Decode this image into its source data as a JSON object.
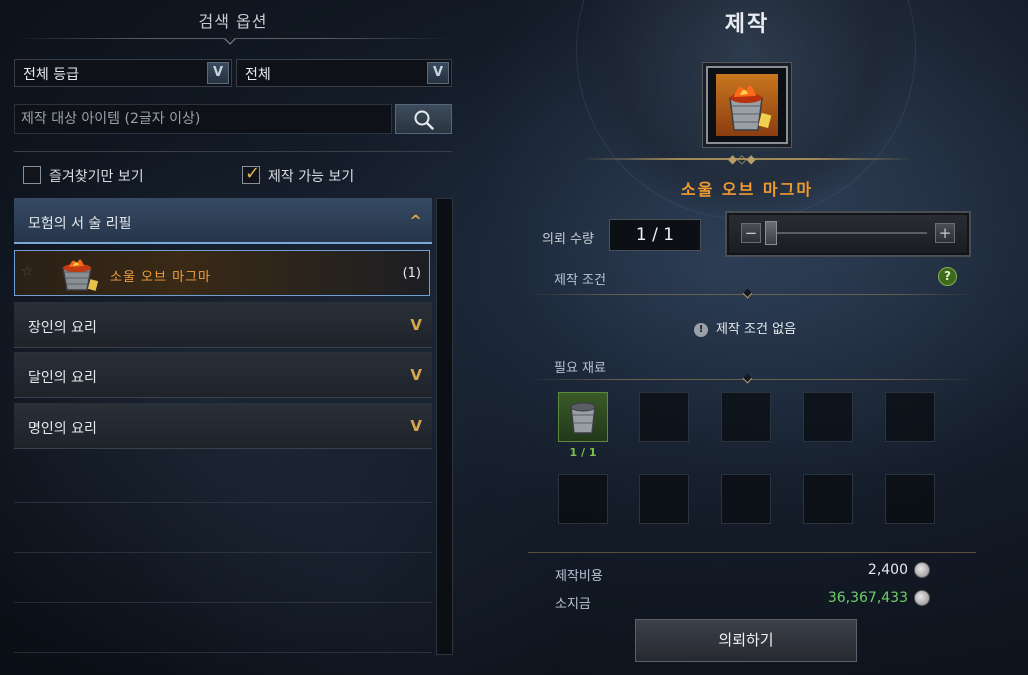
{
  "search": {
    "title": "검색 옵션",
    "grade_select": "전체 등급",
    "type_select": "전체",
    "placeholder": "제작 대상 아이템 (2글자 이상)",
    "favorites_label": "즐겨찾기만 보기",
    "favorites_checked": false,
    "craftable_label": "제작 가능 보기",
    "craftable_checked": true
  },
  "categories": [
    {
      "label": "모험의 서 술 리필",
      "expanded": true
    },
    {
      "label": "장인의 요리",
      "expanded": false
    },
    {
      "label": "달인의 요리",
      "expanded": false
    },
    {
      "label": "명인의 요리",
      "expanded": false
    }
  ],
  "selected_item": {
    "name": "소울 오브 마그마",
    "count": "(1)"
  },
  "craft": {
    "title": "제작",
    "item_name": "소울 오브 마그마",
    "quantity_label": "의뢰 수량",
    "quantity_value": "1 / 1",
    "minus": "−",
    "plus": "+",
    "conditions_label": "제작 조건",
    "help": "?",
    "no_condition": "제작 조건 없음",
    "info_icon": "!",
    "materials_label": "필요 재료",
    "material_count": "1 / 1",
    "cost_label": "제작비용",
    "cost_value": "2,400",
    "funds_label": "소지금",
    "funds_value": "36,367,433",
    "request_button": "의뢰하기"
  },
  "icons": {
    "chevron_down": "V",
    "chevron_up": "^",
    "check": "✓",
    "star": "☆"
  },
  "colors": {
    "item_orange": "#f29a2e",
    "selection_blue": "#6f9ed4",
    "funds_green": "#6fcf6a",
    "accent_gold": "#d8a64c"
  }
}
